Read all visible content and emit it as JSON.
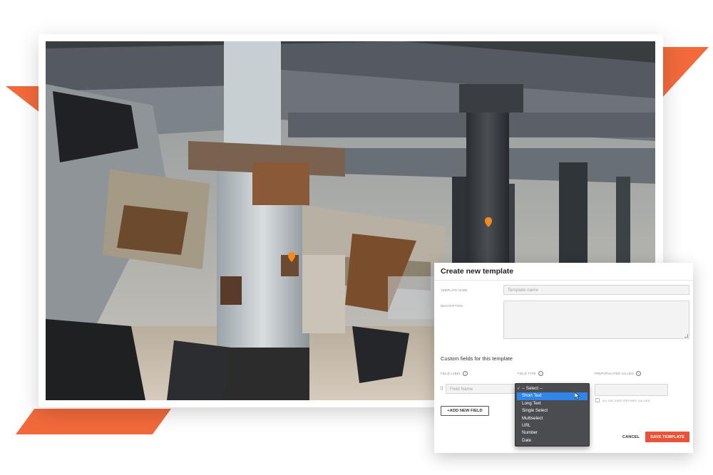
{
  "modal": {
    "title": "Create new template",
    "template_name_label": "TEMPLATE NAME",
    "template_name_placeholder": "Template name",
    "description_label": "DESCRIPTION",
    "custom_fields_title": "Custom fields for this template",
    "columns": {
      "field_label": "FIELD LABEL",
      "field_type": "FIELD TYPE",
      "prepopulated_values": "PREPOPULATED VALUES"
    },
    "field_name_placeholder": "Field Name",
    "allow_user_defined_label": "ALLOW USER DEFINED VALUES",
    "add_field_button": "+ADD NEW FIELD",
    "cancel_button": "CANCEL",
    "save_button": "SAVE TEMPLATE"
  },
  "dropdown": {
    "options": [
      "-- Select --",
      "Short Text",
      "Long Text",
      "Single Select",
      "Multiselect",
      "URL",
      "Number",
      "Date"
    ],
    "selected": "-- Select --",
    "highlighted": "Short Text"
  },
  "colors": {
    "accent": "#f26a3b",
    "save_button": "#e8533a",
    "dropdown_bg": "#4a4c4f",
    "dropdown_highlight": "#2f86e8",
    "marker": "#f28a1e"
  },
  "icons": {
    "info": "info-icon",
    "drag": "drag-handle-icon",
    "map_marker": "location-pin-icon",
    "cursor": "mouse-pointer-icon"
  }
}
